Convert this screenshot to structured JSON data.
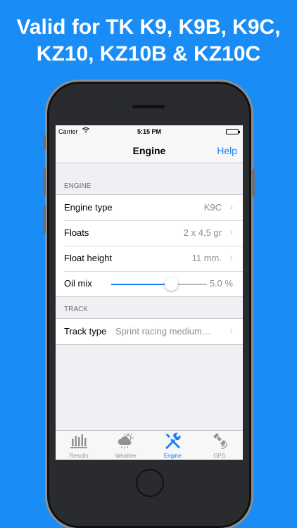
{
  "headline": {
    "line1": "Valid for TK K9, K9B, K9C,",
    "line2": "KZ10, KZ10B & KZ10C"
  },
  "status_bar": {
    "carrier": "Carrier",
    "time": "5:15 PM"
  },
  "nav": {
    "title": "Engine",
    "help": "Help"
  },
  "engine_section": {
    "header": "ENGINE",
    "rows": [
      {
        "label": "Engine type",
        "value": "K9C"
      },
      {
        "label": "Floats",
        "value": "2 x 4,5 gr"
      },
      {
        "label": "Float height",
        "value": "11 mm."
      }
    ],
    "oil_mix": {
      "label": "Oil mix",
      "value": "5.0 %",
      "slider_fraction": 0.63
    }
  },
  "track_section": {
    "header": "TRACK",
    "rows": [
      {
        "label": "Track type",
        "value": "Sprint racing medium…"
      }
    ]
  },
  "tabbar": {
    "tabs": [
      {
        "label": "Results",
        "icon": "bar-chart-icon"
      },
      {
        "label": "Weather",
        "icon": "weather-cloud-icon"
      },
      {
        "label": "Engine",
        "icon": "wrench-screwdriver-icon",
        "active": true
      },
      {
        "label": "GPS",
        "icon": "satellite-icon"
      }
    ]
  },
  "colors": {
    "background": "#1a8cf5",
    "accent": "#157efb"
  }
}
